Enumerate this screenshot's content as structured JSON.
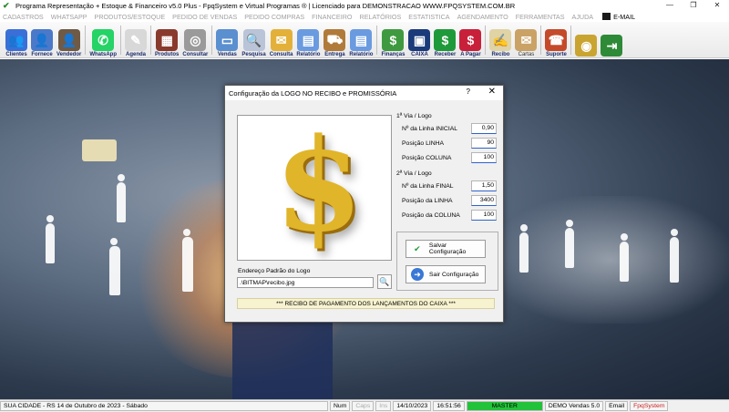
{
  "window": {
    "title": "Programa Representação + Estoque & Financeiro v5.0 Plus - FpqSystem e Virtual Programas ® | Licenciado para  DEMONSTRACAO WWW.FPQSYSTEM.COM.BR",
    "minimize": "—",
    "restore": "❐",
    "close": "✕"
  },
  "menu": {
    "items": [
      "CADASTROS",
      "WHATSAPP",
      "PRODUTOS/ESTOQUE",
      "PEDIDO DE VENDAS",
      "PEDIDO COMPRAS",
      "FINANCEIRO",
      "RELATÓRIOS",
      "ESTATISTICA",
      "AGENDAMENTO",
      "FERRAMENTAS",
      "AJUDA"
    ],
    "email": "E-MAIL"
  },
  "toolbar": {
    "buttons": [
      {
        "label": "Clientes",
        "icon": "clients-icon",
        "color": "#3a6fd8",
        "glyph": "👥"
      },
      {
        "label": "Fornece",
        "icon": "supplier-icon",
        "color": "#4a79c9",
        "glyph": "👤"
      },
      {
        "label": "Vendedor",
        "icon": "seller-icon",
        "color": "#6f5a46",
        "glyph": "👤"
      },
      {
        "label": "WhatsApp",
        "icon": "whatsapp-icon",
        "color": "#25d366",
        "glyph": "✆"
      },
      {
        "label": "Agenda",
        "icon": "agenda-icon",
        "color": "#d8d8d8",
        "glyph": "✎"
      },
      {
        "label": "Produtos",
        "icon": "products-icon",
        "color": "#8a3a2c",
        "glyph": "▦"
      },
      {
        "label": "Consultar",
        "icon": "consult-icon",
        "color": "#9a9a9a",
        "glyph": "◎"
      },
      {
        "label": "Vendas",
        "icon": "sales-icon",
        "color": "#5a8fd0",
        "glyph": "▭"
      },
      {
        "label": "Pesquisa",
        "icon": "search-icon",
        "color": "#b9c4d8",
        "glyph": "🔍"
      },
      {
        "label": "Consulta",
        "icon": "folder-icon",
        "color": "#e3b13a",
        "glyph": "✉"
      },
      {
        "label": "Relatório",
        "icon": "report-icon",
        "color": "#6a9be0",
        "glyph": "▤"
      },
      {
        "label": "Entrega",
        "icon": "delivery-icon",
        "color": "#b07a3a",
        "glyph": "⛟"
      },
      {
        "label": "Relatório",
        "icon": "report2-icon",
        "color": "#6a9be0",
        "glyph": "▤"
      },
      {
        "label": "Finanças",
        "icon": "finance-icon",
        "color": "#3f9a3f",
        "glyph": "$"
      },
      {
        "label": "CAIXA",
        "icon": "cashier-icon",
        "color": "#1b3a7a",
        "glyph": "▣"
      },
      {
        "label": "Receber",
        "icon": "receive-icon",
        "color": "#1f9a3a",
        "glyph": "$"
      },
      {
        "label": "A Pagar",
        "icon": "pay-icon",
        "color": "#c8203a",
        "glyph": "$"
      },
      {
        "label": "Recibo",
        "icon": "receipt-icon",
        "color": "#e0d3a4",
        "glyph": "✍"
      },
      {
        "label": "Cartas",
        "icon": "letters-icon",
        "color": "#caa266",
        "glyph": "✉"
      },
      {
        "label": "Suporte",
        "icon": "support-icon",
        "color": "#c44a2a",
        "glyph": "☎"
      },
      {
        "label": "",
        "icon": "coin-icon",
        "color": "#c9a431",
        "glyph": "◉"
      },
      {
        "label": "",
        "icon": "exit-icon",
        "color": "#2e8a36",
        "glyph": "⇥"
      }
    ]
  },
  "dialog": {
    "title": "Configuração da LOGO NO RECIBO e PROMISSÓRIA",
    "help": "?",
    "close": "✕",
    "logo_glyph": "$",
    "address_label": "Endereço Padrão do Logo",
    "address_value": ".\\BITMAP\\recibo.jpg",
    "search_glyph": "🔍",
    "first_copy": {
      "title": "1ª Via / Logo",
      "rows": [
        {
          "label": "Nº da Linha INICIAL",
          "value": "0,90"
        },
        {
          "label": "Posição LINHA",
          "value": "90"
        },
        {
          "label": "Posição COLUNA",
          "value": "100"
        }
      ]
    },
    "second_copy": {
      "title": "2ª Via / Logo",
      "rows": [
        {
          "label": "Nº da Linha FINAL",
          "value": "1,50"
        },
        {
          "label": "Posição da LINHA",
          "value": "3400"
        },
        {
          "label": "Posição da COLUNA",
          "value": "100"
        }
      ]
    },
    "save_button": "Salvar Configuração",
    "exit_button": "Sair Configuração",
    "footer": "*** RECIBO DE PAGAMENTO DOS LANÇAMENTOS DO CAIXA ***"
  },
  "status": {
    "city_date": "SUA CIDADE - RS 14 de Outubro de 2023 - Sábado",
    "num": "Num",
    "caps": "Caps",
    "ins": "Ins",
    "date": "14/10/2023",
    "time": "16:51:56",
    "master": "MASTER",
    "demo": "DEMO Vendas 5.0",
    "email": "Email",
    "brand": "FpqSystem"
  }
}
